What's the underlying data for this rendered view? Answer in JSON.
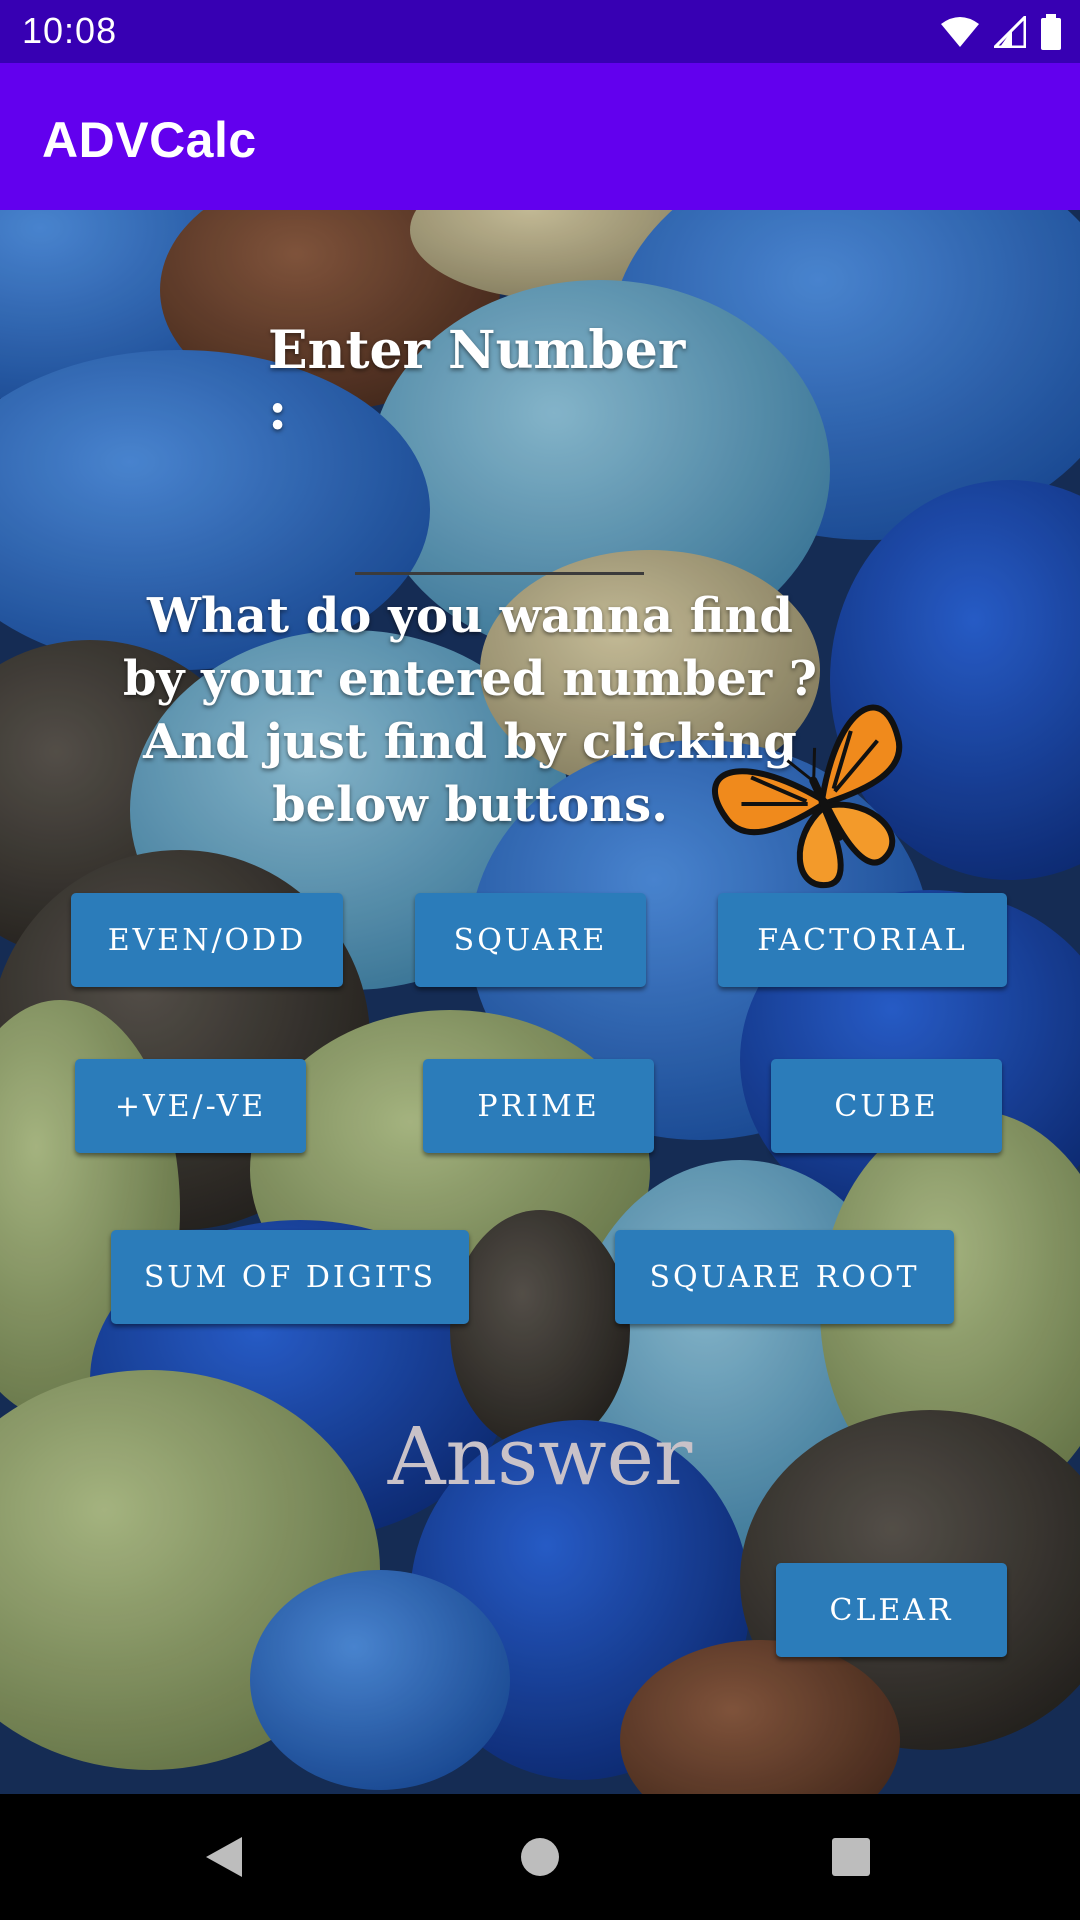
{
  "status_bar": {
    "time": "10:08",
    "icons": [
      "wifi-icon",
      "signal-icon",
      "battery-icon"
    ]
  },
  "app_bar": {
    "title": "ADVCalc"
  },
  "form": {
    "enter_label": "Enter Number :",
    "input_value": "",
    "instructions": "What do you wanna find\nby your entered number ?\nAnd just find by clicking\nbelow buttons."
  },
  "buttons": {
    "even_odd": "EVEN/ODD",
    "square": "SQUARE",
    "factorial": "FACTORIAL",
    "pos_neg": "+VE/-VE",
    "prime": "PRIME",
    "cube": "CUBE",
    "sum_digits": "SUM OF DIGITS",
    "square_root": "SQUARE ROOT",
    "clear": "CLEAR"
  },
  "answer": {
    "placeholder": "Answer"
  },
  "nav_bar": {
    "icons": [
      "back-icon",
      "home-icon",
      "recents-icon"
    ]
  },
  "colors": {
    "status_bar": "#3700b3",
    "app_bar": "#6200ee",
    "button": "#2b7cba"
  }
}
